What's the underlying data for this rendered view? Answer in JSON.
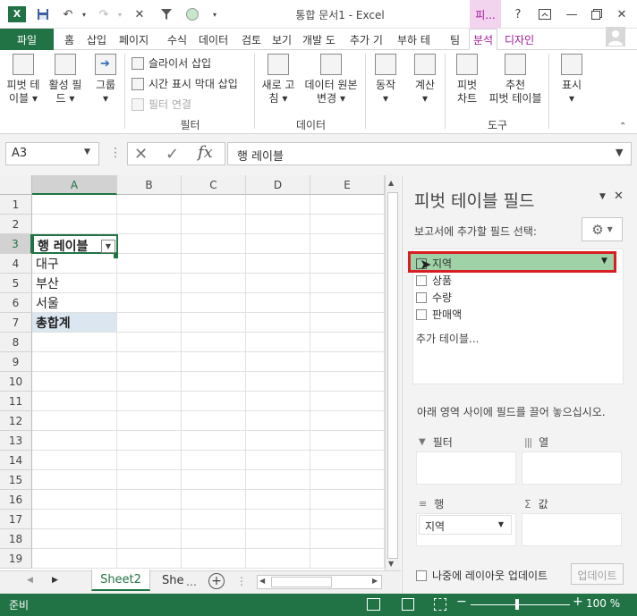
{
  "titlebar": {
    "title": "통합 문서1 - Excel",
    "context_tab": "피...",
    "app_icon": "excel-icon",
    "help": "?"
  },
  "tabs": [
    "파일",
    "홈",
    "삽입",
    "페이지",
    "수식",
    "데이터",
    "검토",
    "보기",
    "개발 도",
    "추가 기",
    "부하 테",
    "팀",
    "분석",
    "디자인"
  ],
  "ribbon": {
    "pivot_table_top": "피벗 테",
    "pivot_table_bottom": "이블",
    "active_field_top": "활성 필",
    "active_field_bottom": "드",
    "group_label": "그룹",
    "slicer": "슬라이서 삽입",
    "timeline": "시간 표시 막대 삽입",
    "filter_connections": "필터 연결",
    "filter_group": "필터",
    "refresh_top": "새로 고",
    "refresh_bottom": "침",
    "change_source_top": "데이터 원본",
    "change_source_bottom": "변경",
    "data_group": "데이터",
    "actions": "동작",
    "calculations": "계산",
    "pivot_chart_top": "피벗",
    "pivot_chart_bottom": "차트",
    "recommended_top": "추천",
    "recommended_bottom": "피벗 테이블",
    "tools_group": "도구",
    "show": "표시"
  },
  "formula_bar": {
    "namebox": "A3",
    "content": "행 레이블"
  },
  "grid": {
    "columns": [
      "A",
      "B",
      "C",
      "D",
      "E"
    ],
    "rows": [
      "1",
      "2",
      "3",
      "4",
      "5",
      "6",
      "7",
      "8",
      "9",
      "10",
      "11",
      "12",
      "13",
      "14",
      "15",
      "16",
      "17",
      "18",
      "19"
    ],
    "a3": "행 레이블",
    "a4": "대구",
    "a5": "부산",
    "a6": "서울",
    "a7": "총합계"
  },
  "sheets": {
    "active": "Sheet2",
    "other": "She"
  },
  "pane": {
    "title": "피벗 테이블 필드",
    "subtitle": "보고서에 추가할 필드 선택:",
    "fields": [
      "지역",
      "상품",
      "수량",
      "판매액"
    ],
    "more_tables": "추가 테이블...",
    "drag_hint": "아래 영역 사이에 필드를 끌어 놓으십시오.",
    "areas": {
      "filters": "필터",
      "columns": "열",
      "rows": "행",
      "values": "값",
      "rows_item": "지역"
    },
    "defer": "나중에 레이아웃 업데이트",
    "update": "업데이트"
  },
  "status": {
    "ready": "준비",
    "zoom": "100 %"
  },
  "colors": {
    "excel_green": "#217346",
    "context_magenta": "#a1169b",
    "highlight_red": "#d81e22",
    "field_green": "#9fd2a6"
  }
}
